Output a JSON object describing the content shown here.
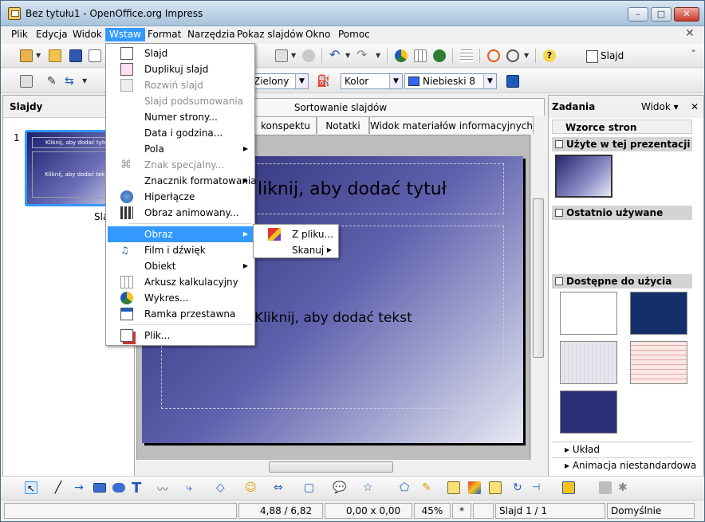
{
  "window": {
    "title": "Bez tytułu1 - OpenOffice.org Impress",
    "min": "–",
    "max": "□",
    "close": "✕"
  },
  "menubar": {
    "items": [
      "Plik",
      "Edycja",
      "Widok",
      "Wstaw",
      "Format",
      "Narzędzia",
      "Pokaz slajdów",
      "Okno",
      "Pomoc"
    ],
    "active": "Wstaw",
    "doc_close": "✕"
  },
  "toolbar2": {
    "line_color": "Zielony",
    "fill_type": "Kolor",
    "fill_color": "Niebieski 8"
  },
  "toolbar1": {
    "slide_button": "Slajd"
  },
  "slides_panel": {
    "header": "Slajdy",
    "thumb_number": "1",
    "thumb_title": "Kliknij, aby dodać tytuł",
    "thumb_body": "Kliknij, aby dodać tekst",
    "thumb_label": "Sla"
  },
  "view_tabs": {
    "row1": [
      "Sortowanie slajdów"
    ],
    "row2": [
      "konspektu",
      "Notatki",
      "Widok materiałów informacyjnych"
    ]
  },
  "slide": {
    "title": "liknij, aby dodać tytuł",
    "body": "Kliknij, aby dodać tekst"
  },
  "tasks_panel": {
    "header": "Zadania",
    "view": "Widok",
    "close": "✕",
    "section_master": "Wzorce stron",
    "used": "Użyte w tej prezentacji",
    "recent": "Ostatnio używane",
    "available": "Dostępne do użycia",
    "layout": "Układ",
    "animation": "Animacja niestandardowa"
  },
  "insert_menu": {
    "items": [
      {
        "label": "Slajd",
        "enabled": true,
        "icon": "slide-icon"
      },
      {
        "label": "Duplikuj slajd",
        "enabled": true,
        "icon": "duplicate-slide-icon"
      },
      {
        "label": "Rozwiń slajd",
        "enabled": false,
        "icon": "expand-slide-icon"
      },
      {
        "label": "Slajd podsumowania",
        "enabled": false,
        "icon": ""
      },
      {
        "label": "Numer strony...",
        "enabled": true,
        "icon": ""
      },
      {
        "label": "Data i godzina...",
        "enabled": true,
        "icon": ""
      },
      {
        "label": "Pola",
        "enabled": true,
        "icon": "",
        "submenu": true
      },
      {
        "label": "Znak specjalny...",
        "enabled": false,
        "icon": "special-char-icon"
      },
      {
        "label": "Znacznik formatowania",
        "enabled": true,
        "icon": "",
        "submenu": true
      },
      {
        "label": "Hiperłącze",
        "enabled": true,
        "icon": "hyperlink-icon"
      },
      {
        "label": "Obraz animowany...",
        "enabled": true,
        "icon": "animated-image-icon"
      },
      {
        "label": "Obraz",
        "enabled": true,
        "icon": "",
        "submenu": true,
        "highlighted": true
      },
      {
        "label": "Film i dźwięk",
        "enabled": true,
        "icon": "movie-sound-icon"
      },
      {
        "label": "Obiekt",
        "enabled": true,
        "icon": "",
        "submenu": true
      },
      {
        "label": "Arkusz kalkulacyjny",
        "enabled": true,
        "icon": "spreadsheet-icon"
      },
      {
        "label": "Wykres...",
        "enabled": true,
        "icon": "chart-icon"
      },
      {
        "label": "Ramka przestawna",
        "enabled": true,
        "icon": "floating-frame-icon"
      },
      {
        "label": "Plik...",
        "enabled": true,
        "icon": "file-icon"
      }
    ]
  },
  "image_submenu": {
    "items": [
      {
        "label": "Z pliku...",
        "icon": "from-file-icon"
      },
      {
        "label": "Skanuj",
        "submenu": true
      }
    ]
  },
  "statusbar": {
    "position": "4,88 / 6,82",
    "size": "0,00 x 0,00",
    "zoom": "45%",
    "modified": "*",
    "slide": "Slajd 1 / 1",
    "master": "Domyślnie"
  },
  "colors": {
    "accent": "#3399ff",
    "slide_dark": "#27286e",
    "menu_bg": "#f0f0f0"
  }
}
